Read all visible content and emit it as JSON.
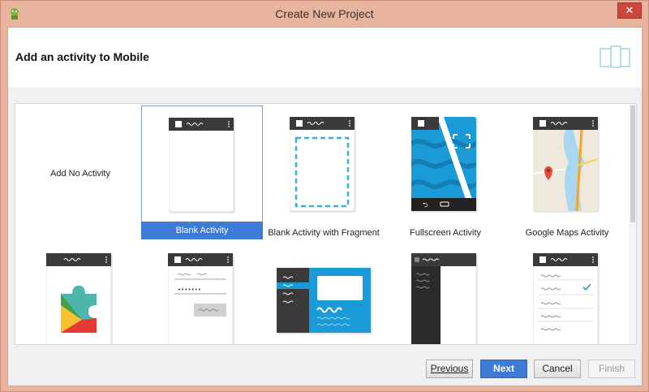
{
  "window": {
    "title": "Create New Project",
    "close_glyph": "✕"
  },
  "header": {
    "title": "Add an activity to Mobile"
  },
  "activities": [
    {
      "label": "Add No Activity"
    },
    {
      "label": "Blank Activity",
      "selected": true
    },
    {
      "label": "Blank Activity with Fragment"
    },
    {
      "label": "Fullscreen Activity"
    },
    {
      "label": "Google Maps Activity"
    },
    {
      "label": ""
    },
    {
      "label": ""
    },
    {
      "label": ""
    },
    {
      "label": ""
    },
    {
      "label": ""
    }
  ],
  "buttons": {
    "previous": "Previous",
    "next": "Next",
    "cancel": "Cancel",
    "finish": "Finish"
  },
  "colors": {
    "accent": "#3e7bd6",
    "close": "#c9473d",
    "frame": "#e8b49e",
    "phone_bar": "#3a3a3a",
    "teal": "#1a9bd7"
  }
}
